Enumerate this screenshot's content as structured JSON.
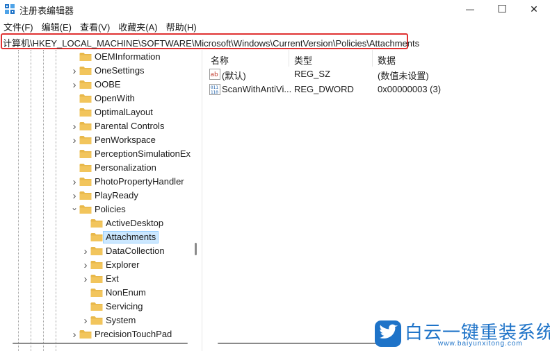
{
  "window": {
    "title": "注册表编辑器",
    "minimize_glyph": "—",
    "maximize_glyph": "☐",
    "close_glyph": "✕"
  },
  "menu": [
    "文件(F)",
    "编辑(E)",
    "查看(V)",
    "收藏夹(A)",
    "帮助(H)"
  ],
  "address": {
    "path": "计算机\\HKEY_LOCAL_MACHINE\\SOFTWARE\\Microsoft\\Windows\\CurrentVersion\\Policies\\Attachments",
    "highlight_color": "#e03131"
  },
  "tree": {
    "items": [
      {
        "label": "OEMInformation",
        "expander": ""
      },
      {
        "label": "OneSettings",
        "expander": "›"
      },
      {
        "label": "OOBE",
        "expander": "›"
      },
      {
        "label": "OpenWith",
        "expander": ""
      },
      {
        "label": "OptimalLayout",
        "expander": ""
      },
      {
        "label": "Parental Controls",
        "expander": "›"
      },
      {
        "label": "PenWorkspace",
        "expander": "›"
      },
      {
        "label": "PerceptionSimulationEx",
        "expander": ""
      },
      {
        "label": "Personalization",
        "expander": ""
      },
      {
        "label": "PhotoPropertyHandler",
        "expander": "›"
      },
      {
        "label": "PlayReady",
        "expander": "›"
      },
      {
        "label": "Policies",
        "expander": "⌄"
      },
      {
        "label": "ActiveDesktop",
        "expander": ""
      },
      {
        "label": "Attachments",
        "expander": "",
        "selected": true
      },
      {
        "label": "DataCollection",
        "expander": "›"
      },
      {
        "label": "Explorer",
        "expander": "›"
      },
      {
        "label": "Ext",
        "expander": "›"
      },
      {
        "label": "NonEnum",
        "expander": ""
      },
      {
        "label": "Servicing",
        "expander": ""
      },
      {
        "label": "System",
        "expander": "›"
      },
      {
        "label": "PrecisionTouchPad",
        "expander": "›"
      }
    ]
  },
  "list": {
    "headers": {
      "name": "名称",
      "type": "类型",
      "data": "数据"
    },
    "rows": [
      {
        "name": "(默认)",
        "type": "REG_SZ",
        "data": "(数值未设置)",
        "icon": "string-value-icon"
      },
      {
        "name": "ScanWithAntiVi...",
        "type": "REG_DWORD",
        "data": "0x00000003 (3)",
        "icon": "binary-value-icon"
      }
    ]
  },
  "watermark": {
    "text": "白云一键重装系统",
    "url": "www.baiyunxitong.com",
    "color": "#1e73c8"
  },
  "colors": {
    "selection_bg": "#cce8ff",
    "folder": "#f2c55c"
  }
}
